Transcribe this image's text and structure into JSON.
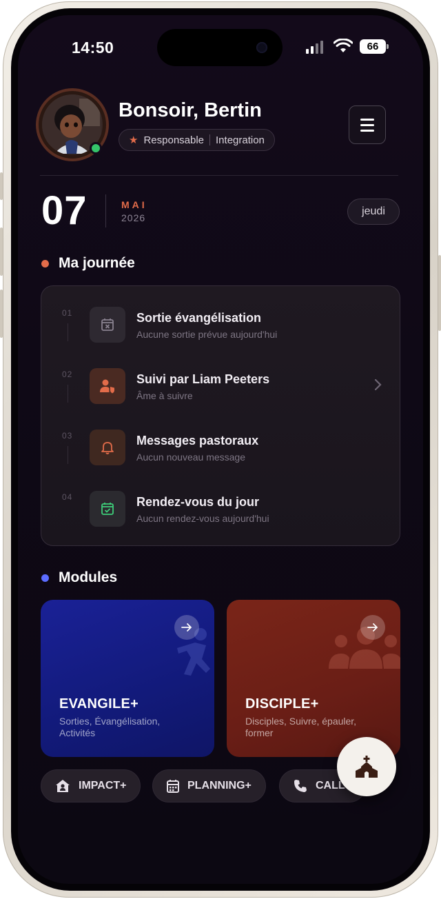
{
  "status_bar": {
    "time": "14:50",
    "battery": "66"
  },
  "header": {
    "greeting": "Bonsoir, Bertin",
    "role": "Responsable",
    "team": "Integration"
  },
  "date": {
    "day": "07",
    "month": "MAI",
    "year": "2026",
    "weekday": "jeudi"
  },
  "my_day": {
    "title": "Ma journée",
    "accent": "#e36c4a",
    "tasks": [
      {
        "num": "01",
        "title": "Sortie évangélisation",
        "subtitle": "Aucune sortie prévue aujourd'hui",
        "icon": "calendar-x-icon"
      },
      {
        "num": "02",
        "title": "Suivi par Liam Peeters",
        "subtitle": "Âme à suivre",
        "icon": "user-shield-icon"
      },
      {
        "num": "03",
        "title": "Messages pastoraux",
        "subtitle": "Aucun nouveau message",
        "icon": "bell-icon"
      },
      {
        "num": "04",
        "title": "Rendez-vous du jour",
        "subtitle": "Aucun rendez-vous aujourd'hui",
        "icon": "calendar-check-icon"
      }
    ]
  },
  "modules": {
    "title": "Modules",
    "accent": "#5b6cff",
    "cards": [
      {
        "title": "EVANGILE+",
        "description": "Sorties, Évangélisation, Activités",
        "color": "#1a2196"
      },
      {
        "title": "DISCIPLE+",
        "description": "Disciples, Suivre, épauler, former",
        "color": "#7a2518"
      }
    ],
    "chips": [
      {
        "label": "IMPACT+",
        "icon": "house-user-icon"
      },
      {
        "label": "PLANNING+",
        "icon": "calendar-icon"
      },
      {
        "label": "CALL+",
        "icon": "phone-icon"
      }
    ]
  },
  "fab": {
    "icon": "church-icon"
  }
}
